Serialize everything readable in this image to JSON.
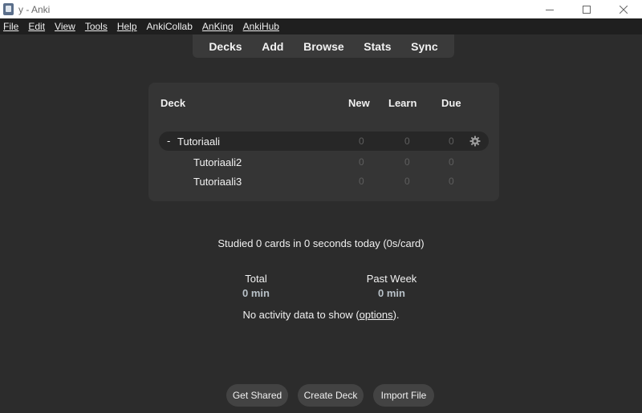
{
  "window": {
    "title": "y - Anki",
    "controls": [
      "minimize-icon",
      "maximize-icon",
      "close-icon"
    ]
  },
  "menubar": {
    "items": [
      {
        "label": "File"
      },
      {
        "label": "Edit"
      },
      {
        "label": "View"
      },
      {
        "label": "Tools"
      },
      {
        "label": "Help"
      },
      {
        "label": "AnkiCollab"
      },
      {
        "label": "AnKing"
      },
      {
        "label": "AnkiHub"
      }
    ]
  },
  "toolbar": {
    "decks": "Decks",
    "add": "Add",
    "browse": "Browse",
    "stats": "Stats",
    "sync": "Sync"
  },
  "deck_list": {
    "headers": {
      "deck": "Deck",
      "new": "New",
      "learn": "Learn",
      "due": "Due"
    },
    "rows": [
      {
        "collapse": "-",
        "name": "Tutoriaali",
        "new": "0",
        "learn": "0",
        "due": "0"
      },
      {
        "name": "Tutoriaali2",
        "new": "0",
        "learn": "0",
        "due": "0"
      },
      {
        "name": "Tutoriaali3",
        "new": "0",
        "learn": "0",
        "due": "0"
      }
    ],
    "options_icon": "gear-icon"
  },
  "stats": {
    "studied": "Studied 0 cards in 0 seconds today (0s/card)",
    "total_label": "Total",
    "total_value": "0 min",
    "past_week_label": "Past Week",
    "past_week_value": "0 min",
    "no_activity_prefix": "No activity data to show (",
    "options_link": "options",
    "no_activity_suffix": ")."
  },
  "bottom_buttons": {
    "get_shared": "Get Shared",
    "create_deck": "Create Deck",
    "import_file": "Import File"
  }
}
